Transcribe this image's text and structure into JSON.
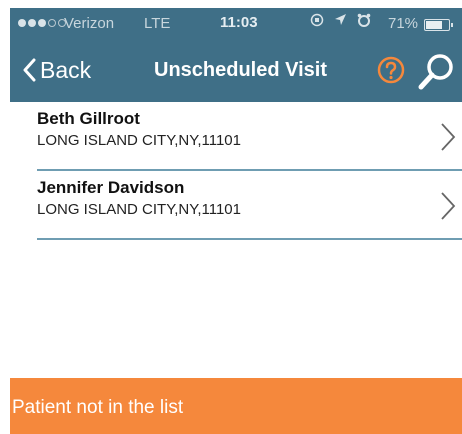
{
  "status_bar": {
    "carrier": "Verizon",
    "network": "LTE",
    "time": "11:03",
    "battery_percent": "71%",
    "battery_level": 0.71,
    "signal_bars": 3,
    "signal_total": 5
  },
  "nav": {
    "back_label": "Back",
    "title": "Unscheduled Visit"
  },
  "patients": [
    {
      "name": "Beth Gillroot",
      "address": "LONG ISLAND CITY,NY,11101"
    },
    {
      "name": "Jennifer Davidson",
      "address": "LONG ISLAND CITY,NY,11101"
    }
  ],
  "footer": {
    "not_in_list_label": "Patient not in the list"
  },
  "colors": {
    "header": "#3f6f87",
    "accent": "#f5883c",
    "divider": "#6f9db2"
  }
}
